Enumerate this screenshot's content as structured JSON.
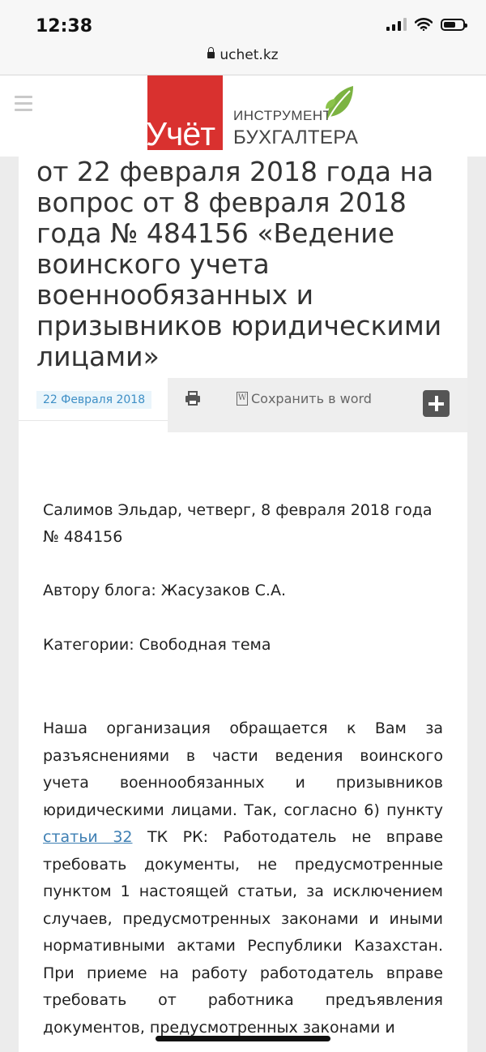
{
  "status_bar": {
    "time": "12:38"
  },
  "browser": {
    "url": "uchet.kz"
  },
  "logo": {
    "word": "Учёт",
    "line1": "ИНСТРУМЕНТ",
    "line2": "БУХГАЛТЕРА"
  },
  "article": {
    "title": "от 22 февраля 2018 года на вопрос от 8 февраля 2018 года № 484156 «Ведение воинского учета военнообязанных и призывников юридическими лицами»",
    "date": "22 Февраля 2018",
    "save_word_label": "Сохранить в word",
    "question_line1": "Салимов Эльдар, четверг, 8 февраля 2018 года",
    "question_line2": "№ 484156",
    "author_line": "Автору блога:  Жасузаков С.А.",
    "category_line": "Категории:  Свободная тема",
    "para_before_link": "Наша организация обращается к Вам за разъяснениями в части ведения воинского учета военнообязанных и призывников юридическими лицами. Так, согласно 6) пункту ",
    "link_text": "статьи 32",
    "para_after_link": " ТК РК: Работодатель не вправе требовать документы, не предусмотренные пунктом 1 настоящей статьи, за исключением случаев, предусмотренных законами и иными нормативными актами Республики Казахстан. При приеме на работу работодатель вправе требовать от работника предъявления документов, предусмотренных законами и"
  },
  "colors": {
    "logo_red": "#d9312f",
    "leaf_green": "#7cb342",
    "link_blue": "#3e7fb3",
    "date_blue": "#3e8fc6"
  },
  "icons": [
    "lock-icon",
    "menu-icon",
    "leaf-icon",
    "print-icon",
    "word-icon",
    "plus-icon"
  ]
}
